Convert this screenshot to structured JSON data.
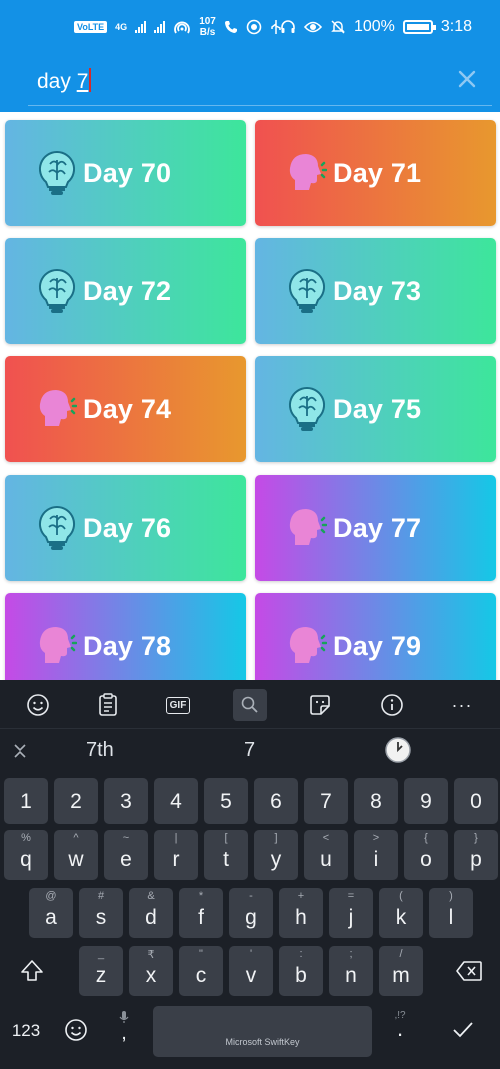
{
  "status_bar": {
    "volte": "VoLTE",
    "network": "4G",
    "speed_value": "107",
    "speed_unit": "B/s",
    "battery": "100%",
    "time": "3:18"
  },
  "search": {
    "prefix": "day ",
    "typed": "7"
  },
  "cards": [
    {
      "label": "Day 70",
      "icon": "brain-bulb-icon",
      "theme": "blue"
    },
    {
      "label": "Day 71",
      "icon": "speaking-head-icon",
      "theme": "orange"
    },
    {
      "label": "Day 72",
      "icon": "brain-bulb-icon",
      "theme": "blue"
    },
    {
      "label": "Day 73",
      "icon": "brain-bulb-icon",
      "theme": "blue"
    },
    {
      "label": "Day 74",
      "icon": "speaking-head-icon",
      "theme": "orange"
    },
    {
      "label": "Day 75",
      "icon": "brain-bulb-icon",
      "theme": "blue"
    },
    {
      "label": "Day 76",
      "icon": "brain-bulb-icon",
      "theme": "blue"
    },
    {
      "label": "Day 77",
      "icon": "speaking-head-icon",
      "theme": "purple"
    },
    {
      "label": "Day 78",
      "icon": "speaking-head-icon",
      "theme": "purple"
    },
    {
      "label": "Day 79",
      "icon": "speaking-head-icon",
      "theme": "purple"
    }
  ],
  "keyboard": {
    "toolbar": [
      "emoji-icon",
      "clipboard-icon",
      "gif-icon",
      "search-icon",
      "sticker-icon",
      "info-icon",
      "more-icon"
    ],
    "gif_label": "GIF",
    "more_label": "···",
    "suggestions": [
      "7th",
      "7"
    ],
    "number_row": [
      "1",
      "2",
      "3",
      "4",
      "5",
      "6",
      "7",
      "8",
      "9",
      "0"
    ],
    "row1": [
      {
        "main": "q",
        "sub": "%"
      },
      {
        "main": "w",
        "sub": "^"
      },
      {
        "main": "e",
        "sub": "~"
      },
      {
        "main": "r",
        "sub": "|"
      },
      {
        "main": "t",
        "sub": "["
      },
      {
        "main": "y",
        "sub": "]"
      },
      {
        "main": "u",
        "sub": "<"
      },
      {
        "main": "i",
        "sub": ">"
      },
      {
        "main": "o",
        "sub": "{"
      },
      {
        "main": "p",
        "sub": "}"
      }
    ],
    "row2": [
      {
        "main": "a",
        "sub": "@"
      },
      {
        "main": "s",
        "sub": "#"
      },
      {
        "main": "d",
        "sub": "&"
      },
      {
        "main": "f",
        "sub": "*"
      },
      {
        "main": "g",
        "sub": "-"
      },
      {
        "main": "h",
        "sub": "+"
      },
      {
        "main": "j",
        "sub": "="
      },
      {
        "main": "k",
        "sub": "("
      },
      {
        "main": "l",
        "sub": ")"
      }
    ],
    "row3": [
      {
        "main": "z",
        "sub": "_"
      },
      {
        "main": "x",
        "sub": "₹"
      },
      {
        "main": "c",
        "sub": "\""
      },
      {
        "main": "v",
        "sub": "'"
      },
      {
        "main": "b",
        "sub": ":"
      },
      {
        "main": "n",
        "sub": ";"
      },
      {
        "main": "m",
        "sub": "/"
      }
    ],
    "num_toggle": "123",
    "comma": ",",
    "space_label": "Microsoft SwiftKey",
    "period": ".",
    "period_sub": ",!?"
  }
}
